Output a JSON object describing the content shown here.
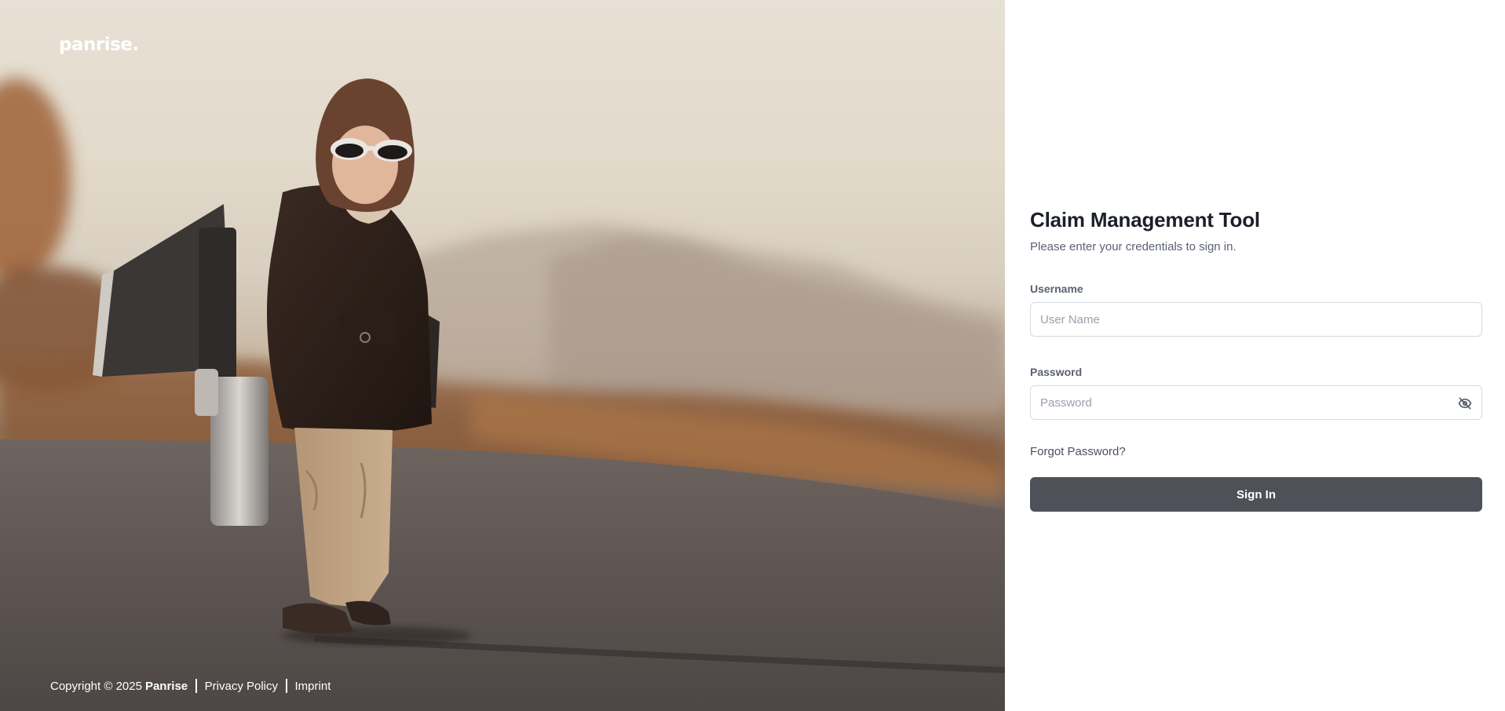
{
  "brand": {
    "logo_text": "panrise."
  },
  "hero": {
    "image_subject": "child-aviator-with-jetpack"
  },
  "footer": {
    "copyright_prefix": "Copyright © 2025",
    "company": "Panrise",
    "privacy_label": "Privacy Policy",
    "imprint_label": "Imprint"
  },
  "login": {
    "title": "Claim Management Tool",
    "subtitle": "Please enter your credentials to sign in.",
    "username_label": "Username",
    "username_placeholder": "User Name",
    "username_value": "",
    "password_label": "Password",
    "password_placeholder": "Password",
    "password_value": "",
    "forgot_label": "Forgot Password?",
    "signin_label": "Sign In"
  },
  "colors": {
    "button_bg": "#4f5159",
    "title_text": "#1b1f2a",
    "muted_text": "#5b6170",
    "input_border": "#d7dae0"
  },
  "icons": {
    "password_toggle": "eye-off-icon"
  }
}
